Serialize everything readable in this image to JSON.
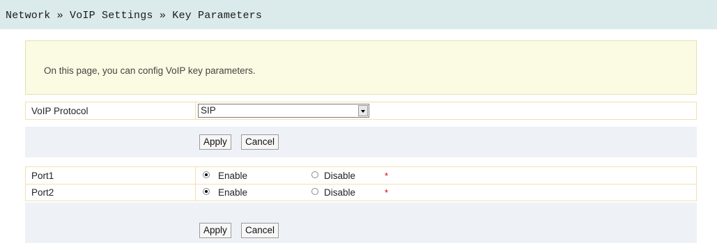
{
  "breadcrumb": {
    "text": "Network » VoIP Settings » Key Parameters"
  },
  "info": {
    "text": "On this page, you can config VoIP key parameters."
  },
  "protocol": {
    "label": "VoIP Protocol",
    "selected": "SIP"
  },
  "buttons": {
    "apply": "Apply",
    "cancel": "Cancel"
  },
  "ports": [
    {
      "label": "Port1",
      "enable": "Enable",
      "disable": "Disable",
      "state": "enable",
      "required": "*"
    },
    {
      "label": "Port2",
      "enable": "Enable",
      "disable": "Disable",
      "state": "enable",
      "required": "*"
    }
  ]
}
